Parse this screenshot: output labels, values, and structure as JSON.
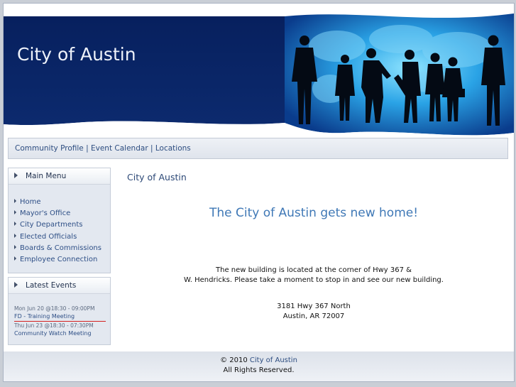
{
  "site": {
    "title": "City of Austin"
  },
  "topnav": {
    "links": [
      "Community Profile",
      "Event Calendar",
      "Locations"
    ],
    "separator": "|"
  },
  "main_menu": {
    "title": "Main Menu",
    "items": [
      "Home",
      "Mayor's Office",
      "City Departments",
      "Elected Officials",
      "Boards & Commissions",
      "Employee Connection"
    ]
  },
  "latest_events": {
    "title": "Latest Events",
    "events": [
      {
        "date": "Mon Jun 20 @18:30 - 09:00PM",
        "title": "FD - Training Meeting"
      },
      {
        "date": "Thu Jun 23 @18:30 - 07:30PM",
        "title": "Community Watch Meeting"
      }
    ]
  },
  "content": {
    "page_title": "City of Austin",
    "headline": "The City of Austin gets new home!",
    "paragraph_line1": "The new building is located at the corner of Hwy 367 &",
    "paragraph_line2": "W. Hendricks.  Please take a moment to stop in and see our new building.",
    "address_line1": "3181 Hwy 367 North",
    "address_line2": "Austin, AR 72007"
  },
  "footer": {
    "copyright": "© 2010",
    "link": "City of Austin",
    "rights": "All Rights Reserved."
  },
  "colors": {
    "header_navy": "#0a2466",
    "link_blue": "#2d4d80",
    "headline_blue": "#3f78b6",
    "event_rule": "#d42020"
  }
}
